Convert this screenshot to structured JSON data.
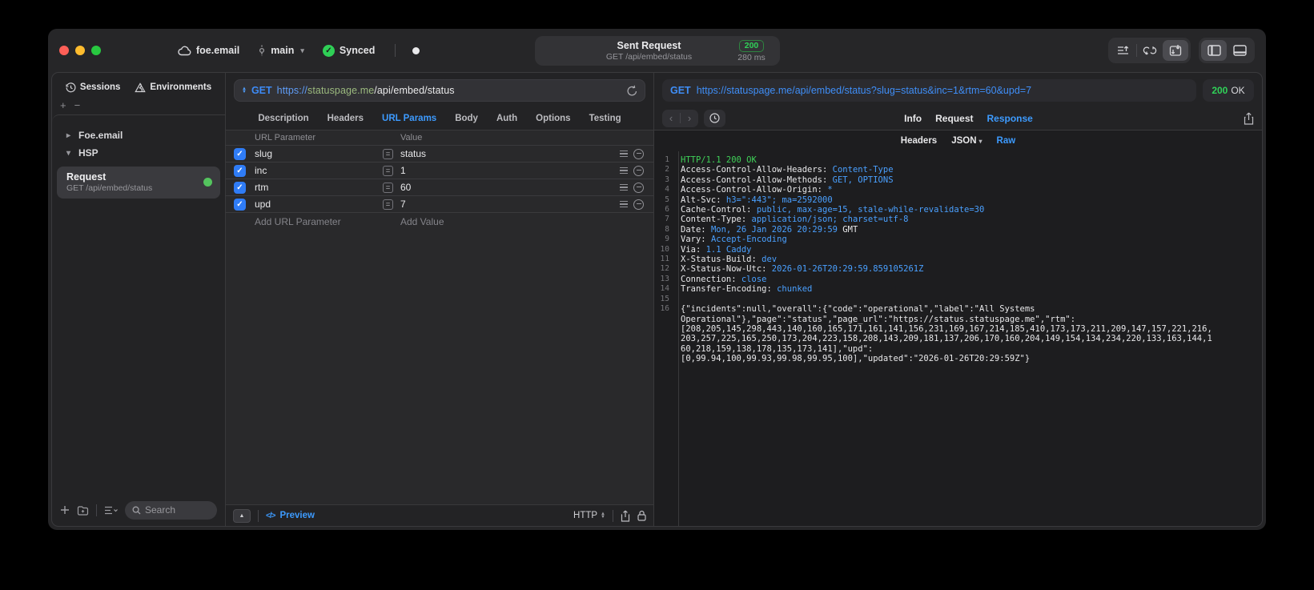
{
  "titlebar": {
    "project": "foe.email",
    "branch": "main",
    "sync_status": "Synced",
    "request_summary": {
      "title": "Sent Request",
      "subtitle": "GET /api/embed/status",
      "status_code": "200",
      "duration": "280 ms"
    }
  },
  "sidebar": {
    "tabs": [
      {
        "label": "Sessions"
      },
      {
        "label": "Environments"
      }
    ],
    "add_label": "+",
    "remove_label": "−",
    "tree": [
      {
        "label": "Foe.email"
      },
      {
        "label": "HSP"
      }
    ],
    "request_item": {
      "title": "Request",
      "subtitle": "GET /api/embed/status"
    },
    "search_placeholder": "Search"
  },
  "request_pane": {
    "method": "GET",
    "url": {
      "scheme": "https://",
      "host": "statuspage.me",
      "path": "/api/embed/status"
    },
    "tabs": [
      "Description",
      "Headers",
      "URL Params",
      "Body",
      "Auth",
      "Options",
      "Testing"
    ],
    "active_tab": "URL Params",
    "params": {
      "col_name": "URL Parameter",
      "col_value": "Value",
      "eq": "=",
      "rows": [
        {
          "name": "slug",
          "value": "status",
          "checked": true
        },
        {
          "name": "inc",
          "value": "1",
          "checked": true
        },
        {
          "name": "rtm",
          "value": "60",
          "checked": true
        },
        {
          "name": "upd",
          "value": "7",
          "checked": true
        }
      ],
      "add_name": "Add URL Parameter",
      "add_value": "Add Value"
    },
    "footer": {
      "preview": "Preview",
      "code_glyph": "</>",
      "protocol": "HTTP"
    }
  },
  "response_pane": {
    "method": "GET",
    "url": "https://statuspage.me/api/embed/status?slug=status&inc=1&rtm=60&upd=7",
    "status": {
      "code": "200",
      "text": "OK"
    },
    "tabs": [
      "Info",
      "Request",
      "Response"
    ],
    "active_tab": "Response",
    "subtabs": [
      "Headers",
      "JSON",
      "Raw"
    ],
    "active_subtab": "Raw",
    "body_lines": [
      {
        "n": "1",
        "segs": [
          {
            "t": "HTTP/1.1 200 OK",
            "c": "green"
          }
        ]
      },
      {
        "n": "2",
        "segs": [
          {
            "t": "Access-Control-Allow-Headers: "
          },
          {
            "t": "Content-Type",
            "c": "blue"
          }
        ]
      },
      {
        "n": "3",
        "segs": [
          {
            "t": "Access-Control-Allow-Methods: "
          },
          {
            "t": "GET, OPTIONS",
            "c": "blue"
          }
        ]
      },
      {
        "n": "4",
        "segs": [
          {
            "t": "Access-Control-Allow-Origin: "
          },
          {
            "t": "*",
            "c": "blue"
          }
        ]
      },
      {
        "n": "5",
        "segs": [
          {
            "t": "Alt-Svc: "
          },
          {
            "t": "h3=\":443\"; ma=2592000",
            "c": "blue"
          }
        ]
      },
      {
        "n": "6",
        "segs": [
          {
            "t": "Cache-Control: "
          },
          {
            "t": "public, max-age=15, stale-while-revalidate=30",
            "c": "blue"
          }
        ]
      },
      {
        "n": "7",
        "segs": [
          {
            "t": "Content-Type: "
          },
          {
            "t": "application/json; charset=utf-8",
            "c": "blue"
          }
        ]
      },
      {
        "n": "8",
        "segs": [
          {
            "t": "Date: "
          },
          {
            "t": "Mon, 26 Jan 2026 20:29:59",
            "c": "blue"
          },
          {
            "t": " GMT"
          }
        ]
      },
      {
        "n": "9",
        "segs": [
          {
            "t": "Vary: "
          },
          {
            "t": "Accept-Encoding",
            "c": "blue"
          }
        ]
      },
      {
        "n": "10",
        "segs": [
          {
            "t": "Via: "
          },
          {
            "t": "1.1 Caddy",
            "c": "blue"
          }
        ]
      },
      {
        "n": "11",
        "segs": [
          {
            "t": "X-Status-Build: "
          },
          {
            "t": "dev",
            "c": "blue"
          }
        ]
      },
      {
        "n": "12",
        "segs": [
          {
            "t": "X-Status-Now-Utc: "
          },
          {
            "t": "2026-01-26T20:29:59.859105261Z",
            "c": "blue"
          }
        ]
      },
      {
        "n": "13",
        "segs": [
          {
            "t": "Connection: "
          },
          {
            "t": "close",
            "c": "blue"
          }
        ]
      },
      {
        "n": "14",
        "segs": [
          {
            "t": "Transfer-Encoding: "
          },
          {
            "t": "chunked",
            "c": "blue"
          }
        ]
      },
      {
        "n": "15",
        "segs": []
      },
      {
        "n": "16",
        "segs": [
          {
            "t": "{\"incidents\":null,\"overall\":{\"code\":\"operational\",\"label\":\"All Systems"
          }
        ]
      },
      {
        "n": "",
        "segs": [
          {
            "t": "Operational\"},\"page\":\"status\",\"page_url\":\"https://status.statuspage.me\",\"rtm\":"
          }
        ]
      },
      {
        "n": "",
        "segs": [
          {
            "t": "[208,205,145,298,443,140,160,165,171,161,141,156,231,169,167,214,185,410,173,173,211,209,147,157,221,216,"
          }
        ]
      },
      {
        "n": "",
        "segs": [
          {
            "t": "203,257,225,165,250,173,204,223,158,208,143,209,181,137,206,170,160,204,149,154,134,234,220,133,163,144,1"
          }
        ]
      },
      {
        "n": "",
        "segs": [
          {
            "t": "60,218,159,138,178,135,173,141],\"upd\":"
          }
        ]
      },
      {
        "n": "",
        "segs": [
          {
            "t": "[0,99.94,100,99.93,99.98,99.95,100],\"updated\":\"2026-01-26T20:29:59Z\"}"
          }
        ]
      }
    ]
  },
  "icons": {
    "cloud": "cloud-icon",
    "branch": "git-branch-icon",
    "sync": "sync-check-icon",
    "toolbar": [
      "send-list-icon",
      "compare-loops-icon",
      "request-response-icon",
      "left-panel-icon",
      "bottom-panel-icon"
    ],
    "sessions": "clock-history-icon",
    "environments": "environments-prism-icon"
  },
  "colors": {
    "accent_blue": "#3d9bff",
    "success_green": "#30d158",
    "host_green": "#9bb97e",
    "badge_border": "#2e8540"
  }
}
